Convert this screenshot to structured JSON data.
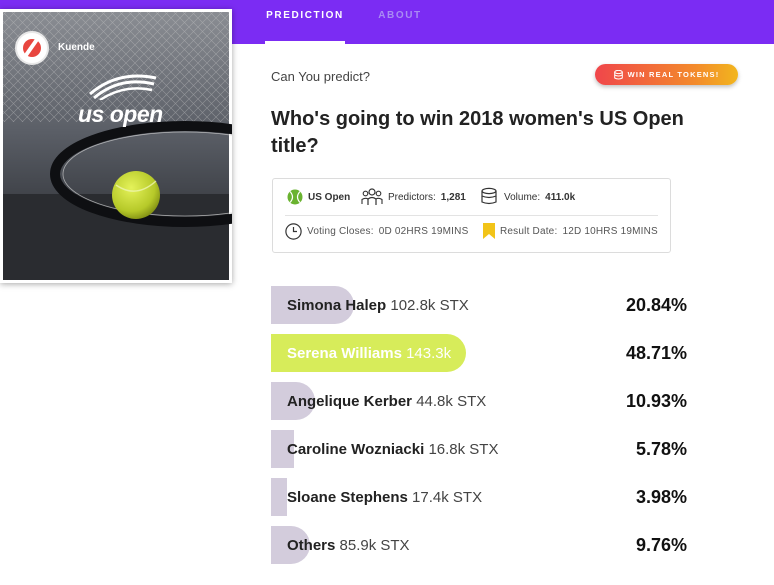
{
  "tabs": [
    {
      "label": "PREDICTION",
      "active": true
    },
    {
      "label": "ABOUT",
      "active": false
    }
  ],
  "card": {
    "brand": "Kuende",
    "event_logo": "us open"
  },
  "header": {
    "eyebrow": "Can You predict?",
    "cta_label": "WIN REAL TOKENS!"
  },
  "question": "Who's going to win 2018 women's US Open title?",
  "info": {
    "category": "US Open",
    "predictors_label": "Predictors:",
    "predictors": "1,281",
    "volume_label": "Volume:",
    "volume": "411.0k",
    "voting_closes_label": "Voting Closes:",
    "voting_closes": "0D 02HRS 19MINS",
    "result_date_label": "Result Date:",
    "result_date": "12D 10HRS 19MINS"
  },
  "colors": {
    "brand_purple": "#7b2cf3",
    "bar": "#d3ccdc",
    "highlight": "#d7ec5a"
  },
  "options": [
    {
      "name": "Simona Halep",
      "volume": "102.8k STX",
      "percent": "20.84%",
      "share": 0.2084,
      "highlight": false
    },
    {
      "name": "Serena Williams",
      "volume": "143.3k",
      "percent": "48.71%",
      "share": 0.4871,
      "highlight": true
    },
    {
      "name": "Angelique Kerber",
      "volume": "44.8k STX",
      "percent": "10.93%",
      "share": 0.1093,
      "highlight": false
    },
    {
      "name": "Caroline Wozniacki",
      "volume": "16.8k STX",
      "percent": "5.78%",
      "share": 0.0578,
      "highlight": false
    },
    {
      "name": "Sloane Stephens",
      "volume": "17.4k STX",
      "percent": "3.98%",
      "share": 0.0398,
      "highlight": false
    },
    {
      "name": "Others",
      "volume": "85.9k STX",
      "percent": "9.76%",
      "share": 0.0976,
      "highlight": false
    }
  ]
}
